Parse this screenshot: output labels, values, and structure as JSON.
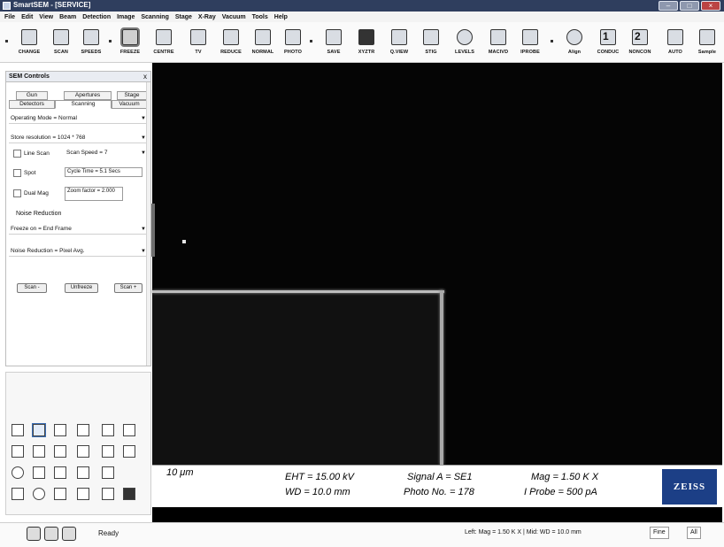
{
  "window": {
    "title": "SmartSEM - [SERVICE]"
  },
  "menu": [
    "File",
    "Edit",
    "View",
    "Beam",
    "Detection",
    "Image",
    "Scanning",
    "Stage",
    "X-Ray",
    "Vacuum",
    "Tools",
    "Help"
  ],
  "toolbar": {
    "buttons": [
      {
        "label": "CHANGE",
        "icon": "change-icon"
      },
      {
        "label": "SCAN",
        "icon": "scan-icon"
      },
      {
        "label": "SPEEDS",
        "icon": "speeds-icon"
      },
      {
        "label": "FREEZE",
        "icon": "freeze-icon",
        "active": true
      },
      {
        "label": "CENTRE",
        "icon": "centre-icon"
      },
      {
        "label": "TV",
        "icon": "tv-icon"
      },
      {
        "label": "REDUCE",
        "icon": "reduce-icon"
      },
      {
        "label": "NORMAL",
        "icon": "normal-icon"
      },
      {
        "label": "PHOTO",
        "icon": "photo-icon"
      },
      {
        "label": "SAVE",
        "icon": "save-icon"
      },
      {
        "label": "XYZTR",
        "icon": "xyztr-icon"
      },
      {
        "label": "Q.VIEW",
        "icon": "quickview-icon"
      },
      {
        "label": "STIG",
        "icon": "stig-icon"
      },
      {
        "label": "LEVELS",
        "icon": "levels-icon"
      },
      {
        "label": "MACIVD",
        "icon": "macivd-icon"
      },
      {
        "label": "IPROBE",
        "icon": "iprobe-icon"
      },
      {
        "label": "Align",
        "icon": "align-icon"
      },
      {
        "label": "CONDUC",
        "icon": "conduc-icon",
        "number": "1"
      },
      {
        "label": "NONCON",
        "icon": "noncon-icon",
        "number": "2"
      },
      {
        "label": "AUTO",
        "icon": "auto-icon"
      },
      {
        "label": "Sample",
        "icon": "sample-icon"
      }
    ]
  },
  "sem_panel": {
    "title": "SEM Controls",
    "close": "x",
    "tabs_top": [
      "Gun",
      "Apertures",
      "Stage"
    ],
    "tabs_bottom": [
      "Detectors",
      "Scanning",
      "Vacuum"
    ],
    "operating_mode": "Operating Mode = Normal",
    "store_resolution": "Store resolution = 1024 * 768",
    "line_scan_label": "Line Scan",
    "scan_speed": "Scan Speed = 7",
    "spot_label": "Spot",
    "cycle_time": "Cycle Time = 5.1 Secs",
    "dual_mag_label": "Dual Mag",
    "zoom_factor": "Zoom factor = 2.000",
    "noise_reduction_label": "Noise Reduction",
    "freeze_on": "Freeze on = End Frame",
    "noise_reduction": "Noise Reduction = Pixel Avg.",
    "buttons": {
      "scan_minus": "Scan -",
      "unfreeze": "Unfreeze",
      "scan_plus": "Scan +"
    }
  },
  "info_bar": {
    "scale": "10 μm",
    "eht": "EHT = 15.00 kV",
    "wd": "WD = 10.0 mm",
    "signal": "Signal A = SE1",
    "photo_no": "Photo No. = 178",
    "mag": "Mag =   1.50 K X",
    "iprobe": "I Probe =   500 pA",
    "logo": "ZEISS"
  },
  "status": {
    "text": "Ready",
    "right": "Left: Mag =   1.50 K X | Mid: WD = 10.0 mm",
    "fine": "Fine",
    "all": "All"
  }
}
